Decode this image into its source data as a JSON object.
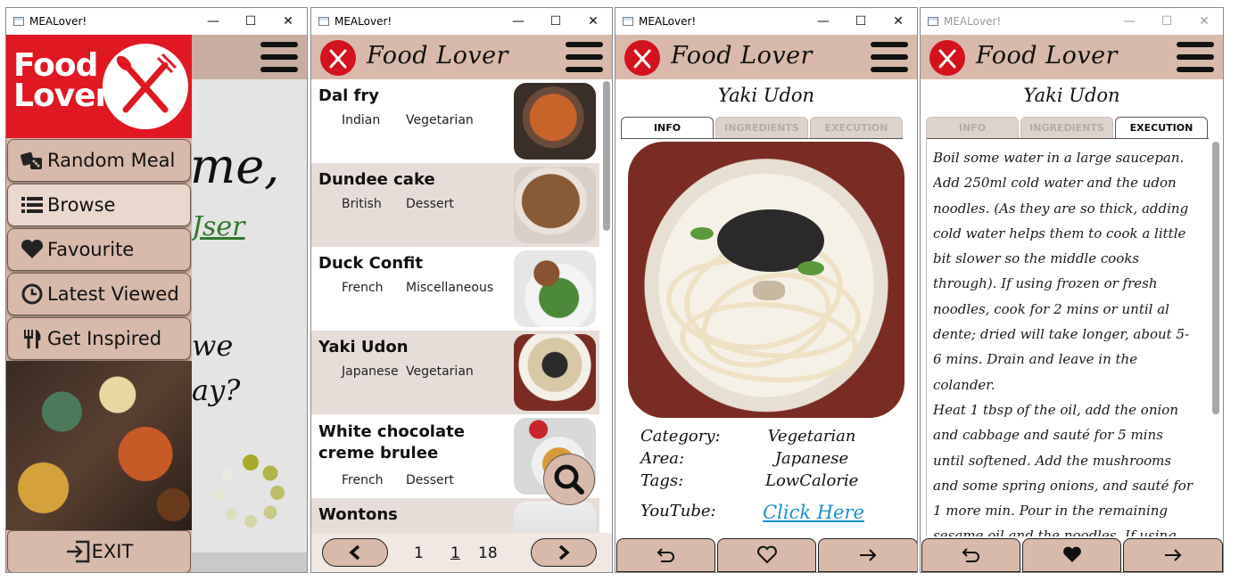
{
  "app_title": "MEALover!",
  "brand": "Food Lover",
  "window_controls": {
    "minimize": "—",
    "maximize": "☐",
    "close": "✕"
  },
  "splash": {
    "logo_line1": "Food",
    "logo_line2": "Lover",
    "welcome_fragment": "me,",
    "user_fragment": "Jser",
    "question_line1": "we",
    "question_line2": "ay?",
    "loader_color": "#a8ab2a"
  },
  "drawer": {
    "items": [
      {
        "label": "Random Meal",
        "icon": "dice-icon"
      },
      {
        "label": "Browse",
        "icon": "list-icon"
      },
      {
        "label": "Favourite",
        "icon": "heart-icon"
      },
      {
        "label": "Latest Viewed",
        "icon": "clock-icon"
      },
      {
        "label": "Get Inspired",
        "icon": "utensils-icon"
      }
    ],
    "active_item": "Browse",
    "exit_label": "EXIT"
  },
  "browse": {
    "meals": [
      {
        "name": "Dal fry",
        "area": "Indian",
        "category": "Vegetarian"
      },
      {
        "name": "Dundee cake",
        "area": "British",
        "category": "Dessert"
      },
      {
        "name": "Duck Confit",
        "area": "French",
        "category": "Miscellaneous"
      },
      {
        "name": "Yaki Udon",
        "area": "Japanese",
        "category": "Vegetarian"
      },
      {
        "name": "White chocolate creme brulee",
        "area": "French",
        "category": "Dessert"
      },
      {
        "name": "Wontons",
        "area": "",
        "category": ""
      }
    ],
    "pager": {
      "first": "1",
      "current": "1",
      "last": "18"
    }
  },
  "detail": {
    "title": "Yaki Udon",
    "tabs": [
      "INFO",
      "INGREDIENTS",
      "EXECUTION"
    ],
    "info": {
      "category_label": "Category:",
      "category": "Vegetarian",
      "area_label": "Area:",
      "area": "Japanese",
      "tags_label": "Tags:",
      "tags": "LowCalorie",
      "youtube_label": "YouTube:",
      "youtube_link": "Click Here"
    },
    "execution_text": "Boil some water in a large saucepan. Add 250ml cold water and the udon noodles. (As they are so thick, adding cold water helps them to cook a little bit slower so the middle cooks through). If using frozen or fresh noodles, cook for 2 mins or until al dente; dried will take longer, about 5-6 mins. Drain and leave in the colander.\nHeat 1 tbsp of the oil, add the onion and cabbage and sauté for 5 mins until softened. Add the mushrooms and some spring onions, and sauté for 1 more min. Pour in the remaining sesame oil and the noodles. If using",
    "bottom_icons": [
      "back-icon",
      "heart-icon",
      "forward-icon"
    ]
  },
  "colors": {
    "header": "#d9b9a9",
    "brand_red": "#d4121c",
    "row_alt": "#e7ddd8",
    "link": "#1a8fd1"
  }
}
